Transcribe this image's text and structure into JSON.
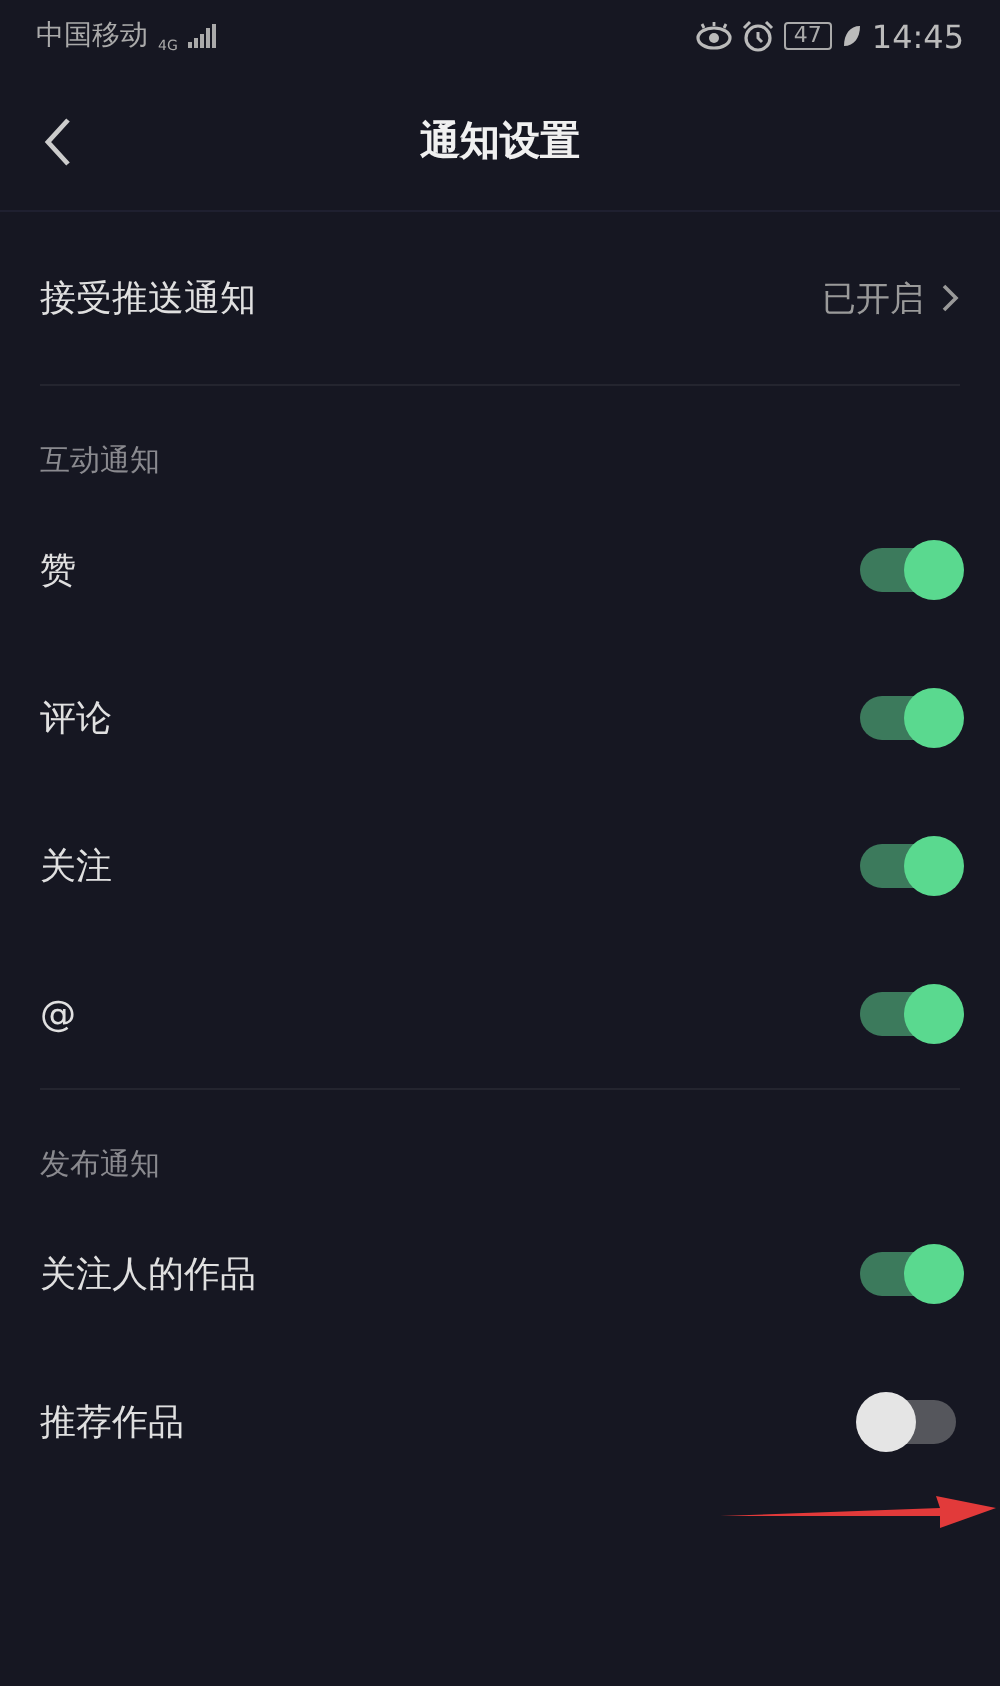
{
  "status_bar": {
    "carrier": "中国移动",
    "network": "4G",
    "battery": "47",
    "time": "14:45"
  },
  "header": {
    "title": "通知设置"
  },
  "push": {
    "label": "接受推送通知",
    "value": "已开启"
  },
  "sections": [
    {
      "title": "互动通知",
      "items": [
        {
          "label": "赞",
          "on": true
        },
        {
          "label": "评论",
          "on": true
        },
        {
          "label": "关注",
          "on": true
        },
        {
          "label": "@",
          "on": true
        }
      ]
    },
    {
      "title": "发布通知",
      "items": [
        {
          "label": "关注人的作品",
          "on": true
        },
        {
          "label": "推荐作品",
          "on": false
        }
      ]
    }
  ]
}
